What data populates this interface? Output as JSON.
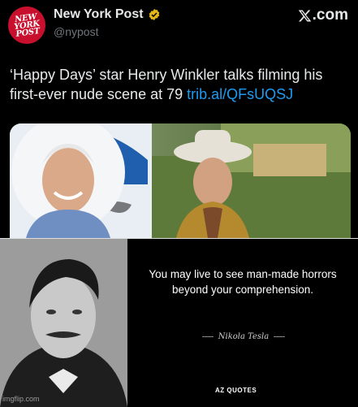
{
  "tweet": {
    "logo_lines": [
      "NEW",
      "YORK",
      "POST"
    ],
    "display_name": "New York Post",
    "handle": "@nypost",
    "x_brand": ".com",
    "text": "‘Happy Days’ star Henry Winkler talks filming his first-ever nude scene at 79",
    "link": "trib.al/QFsUQSJ"
  },
  "quote_panel": {
    "quote": "You may live to see man-made horrors beyond your comprehension.",
    "author": "Nikola Tesla",
    "brand": "AZ QUOTES"
  },
  "watermark": "imgflip.com",
  "colors": {
    "background": "#000000",
    "post_red": "#c8102e",
    "link_blue": "#1d9bf0",
    "verified_gold": "#e2b719"
  },
  "icons": [
    "verified-badge-icon",
    "x-logo-icon"
  ]
}
